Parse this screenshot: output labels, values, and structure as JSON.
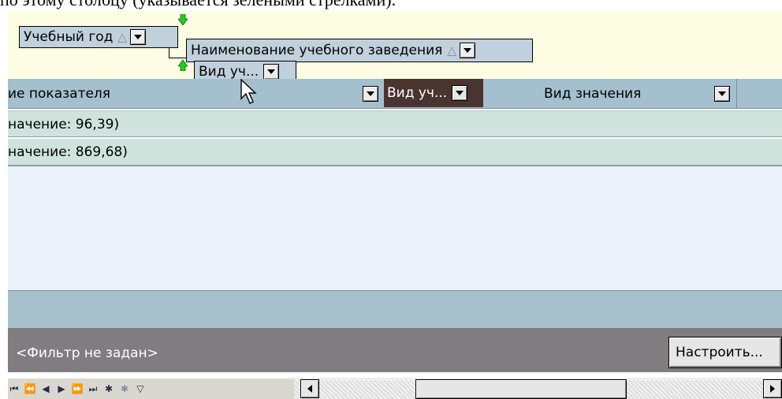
{
  "caption": "по этому столбцу (указывается зелеными стрелками).",
  "group_panel": {
    "chips": [
      {
        "label": "Учебный год",
        "sort": "△"
      },
      {
        "label": "Наименование учебного заведения",
        "sort": "△"
      },
      {
        "label": "Вид уч..."
      }
    ]
  },
  "header": {
    "col_indicator": "ие показателя",
    "col_dragged": "Вид уч...",
    "col_value_type": "Вид значения"
  },
  "rows": [
    {
      "text": "начение: 96,39)"
    },
    {
      "text": "начение: 869,68)"
    }
  ],
  "filter": {
    "status": "<Фильтр не задан>",
    "setup_button": "Настроить..."
  },
  "nav": {
    "icons": [
      "first-icon",
      "prev-page-icon",
      "prev-icon",
      "next-icon",
      "next-page-icon",
      "last-icon",
      "insert-icon",
      "insert-dim-icon",
      "filter-icon"
    ]
  },
  "colors": {
    "group_area": "#fdfde4",
    "header": "#a4bfcd",
    "row": "#cfe3dc",
    "filter_bar": "#807c80",
    "dragged_column": "#4a3430",
    "arrow": "#22cc22"
  }
}
